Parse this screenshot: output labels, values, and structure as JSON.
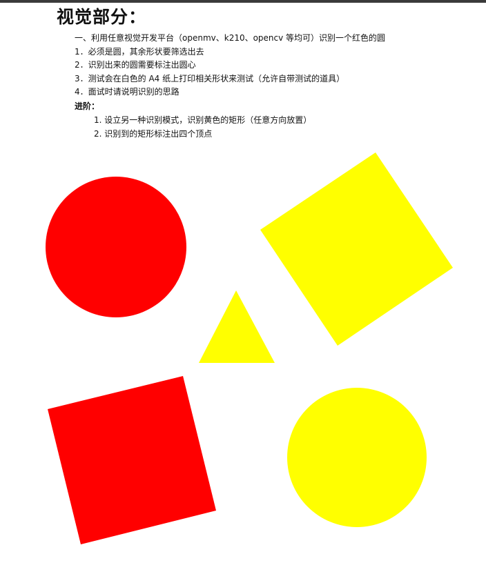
{
  "document": {
    "title": "视觉部分：",
    "requirements": [
      "一、利用任意视觉开发平台（openmv、k210、opencv 等均可）识别一个红色的圆",
      "1．必须是圆，其余形状要筛选出去",
      "2．识别出来的圆需要标注出圆心",
      "3．测试会在白色的 A4 纸上打印相关形状来测试（允许自带测试的道具）",
      "4．面试时请说明识别的思路"
    ],
    "advanced_heading": "进阶：",
    "advanced_items": [
      "1. 设立另一种识别模式，识别黄色的矩形（任意方向放置）",
      "2. 识别到的矩形标注出四个顶点"
    ]
  },
  "shapes": {
    "colors": {
      "red": "#ff0000",
      "yellow": "#ffff00"
    },
    "items": [
      {
        "name": "red-circle",
        "kind": "circle",
        "color": "red"
      },
      {
        "name": "yellow-rotated-square",
        "kind": "rectangle",
        "color": "yellow"
      },
      {
        "name": "yellow-triangle",
        "kind": "triangle",
        "color": "yellow"
      },
      {
        "name": "red-rotated-square",
        "kind": "rectangle",
        "color": "red"
      },
      {
        "name": "yellow-circle",
        "kind": "circle",
        "color": "yellow"
      }
    ]
  }
}
